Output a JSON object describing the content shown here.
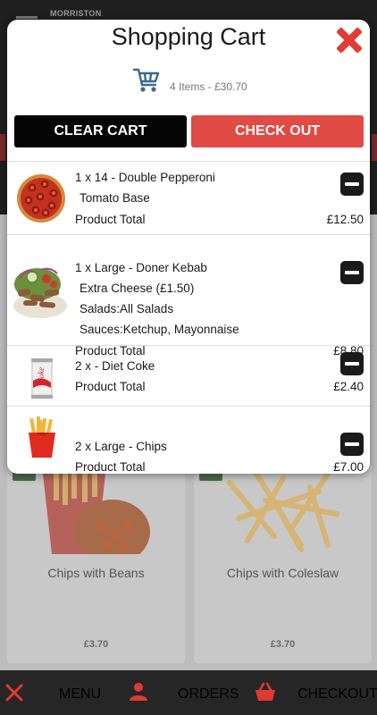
{
  "background": {
    "logo_text": "MORRISTON",
    "products": [
      {
        "name": "Chips with Beans",
        "price": "£3.70"
      },
      {
        "name": "Chips with Coleslaw",
        "price": "£3.70"
      }
    ]
  },
  "bottom_nav": {
    "menu_label": "MENU",
    "orders_label": "ORDERS",
    "checkout_label": "CHECKOUT"
  },
  "cart": {
    "title": "Shopping Cart",
    "summary": "4 Items - £30.70",
    "clear_label": "CLEAR CART",
    "checkout_label": "CHECK OUT",
    "total_label": "Product Total",
    "items": [
      {
        "title": "1 x 14 - Double Pepperoni",
        "options": [
          "Tomato Base"
        ],
        "total": "£12.50",
        "image": "pizza"
      },
      {
        "title": "1 x Large - Doner Kebab",
        "options": [
          {
            "text": "Extra Cheese (£1.50)"
          },
          {
            "label": "Salads:",
            "value": "All Salads"
          },
          {
            "label": "Sauces:",
            "value": "Ketchup, Mayonnaise"
          }
        ],
        "total": "£8.80",
        "image": "kebab"
      },
      {
        "title": "2 x - Diet Coke",
        "options": [],
        "total": "£2.40",
        "image": "coke-can"
      },
      {
        "title": "2 x Large - Chips",
        "options": [],
        "total": "£7.00",
        "image": "chips"
      }
    ]
  },
  "colors": {
    "accent_red": "#e04b45",
    "close_red": "#e03c34",
    "nav_label_red": "#e0392f",
    "button_black": "#050505"
  }
}
